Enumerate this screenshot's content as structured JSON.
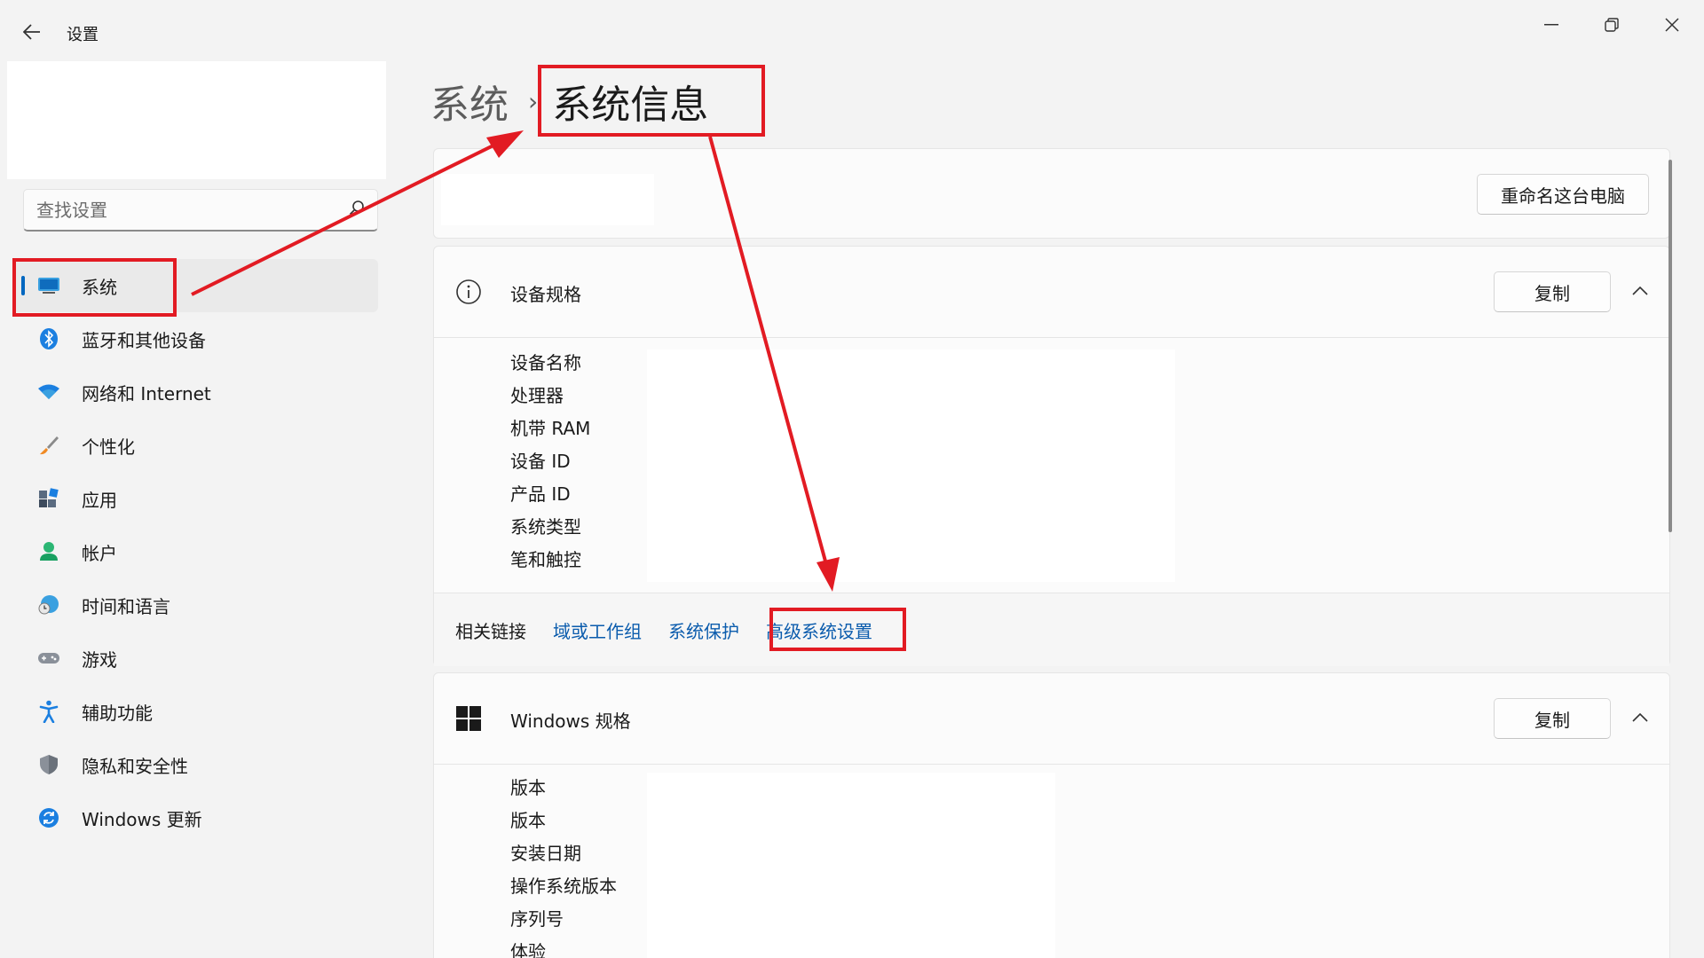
{
  "window": {
    "title": "设置"
  },
  "search": {
    "placeholder": "查找设置"
  },
  "nav": {
    "items": [
      {
        "label": "系统",
        "icon": "monitor-icon",
        "active": true
      },
      {
        "label": "蓝牙和其他设备",
        "icon": "bluetooth-icon"
      },
      {
        "label": "网络和 Internet",
        "icon": "wifi-icon"
      },
      {
        "label": "个性化",
        "icon": "brush-icon"
      },
      {
        "label": "应用",
        "icon": "apps-icon"
      },
      {
        "label": "帐户",
        "icon": "person-icon"
      },
      {
        "label": "时间和语言",
        "icon": "globe-clock-icon"
      },
      {
        "label": "游戏",
        "icon": "gamepad-icon"
      },
      {
        "label": "辅助功能",
        "icon": "accessibility-icon"
      },
      {
        "label": "隐私和安全性",
        "icon": "shield-icon"
      },
      {
        "label": "Windows 更新",
        "icon": "update-icon"
      }
    ]
  },
  "breadcrumb": {
    "parent": "系统",
    "separator": "›",
    "current": "系统信息"
  },
  "device_card": {
    "rename_button": "重命名这台电脑"
  },
  "device_specs": {
    "title": "设备规格",
    "copy_button": "复制",
    "labels": [
      "设备名称",
      "处理器",
      "机带 RAM",
      "设备 ID",
      "产品 ID",
      "系统类型",
      "笔和触控"
    ]
  },
  "related": {
    "label": "相关链接",
    "links": [
      "域或工作组",
      "系统保护",
      "高级系统设置"
    ]
  },
  "windows_specs": {
    "title": "Windows 规格",
    "copy_button": "复制",
    "labels": [
      "版本",
      "版本",
      "安装日期",
      "操作系统版本",
      "序列号",
      "体验"
    ]
  },
  "colors": {
    "accent": "#0067c0",
    "link": "#0b5cad",
    "annotation_red": "#e21b23"
  }
}
